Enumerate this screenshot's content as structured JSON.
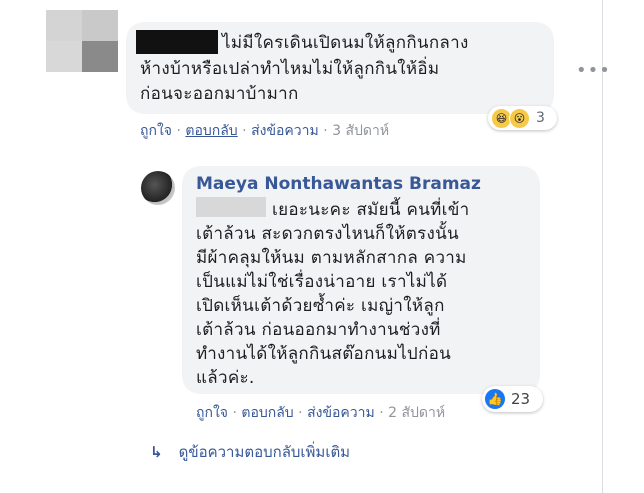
{
  "comment1": {
    "lines": [
      "ไม่มีใครเดินเปิดนมให้ลูกกินกลาง",
      "ห้างบ้าหรือเปล่าทำไหมไม่ให้ลูกกินให้อิ่ม",
      "ก่อนจะออกมาบ้ามาก"
    ],
    "reactions": {
      "icons": [
        "laugh-emoji",
        "wow-emoji"
      ],
      "count": "3"
    },
    "actions": {
      "like": "ถูกใจ",
      "reply": "ตอบกลับ",
      "translate": "ส่งข้อความ",
      "timestamp": "3 สัปดาห์"
    }
  },
  "reply": {
    "author": "Maeya Nonthawantas Bramaz",
    "lines": [
      "เยอะนะคะ สมัยนี้ คนที่เข้า",
      "เต้าล้วน สะดวกตรงไหนก็ให้ตรงนั้น",
      "มีผ้าคลุมให้นม ตามหลักสากล ความ",
      "เป็นแม่ไม่ใช่เรื่องน่าอาย เราไม่ได้",
      "เปิดเห็นเต้าด้วยซ้ำค่ะ เมญ่าให้ลูก",
      "เต้าล้วน ก่อนออกมาทำงานช่วงที่",
      "ทำงานได้ให้ลูกกินสต๊อกนมไปก่อน",
      "แล้วค่ะ."
    ],
    "reactions": {
      "icons": [
        "like-icon"
      ],
      "count": "23"
    },
    "actions": {
      "like": "ถูกใจ",
      "reply": "ตอบกลับ",
      "translate": "ส่งข้อความ",
      "timestamp": "2 สัปดาห์"
    }
  },
  "more_replies": {
    "label": "ดูข้อความตอบกลับเพิ่มเติม"
  },
  "colors": {
    "link": "#385898",
    "bubble": "#f2f3f5",
    "meta": "#90949c",
    "like": "#1877f2"
  }
}
